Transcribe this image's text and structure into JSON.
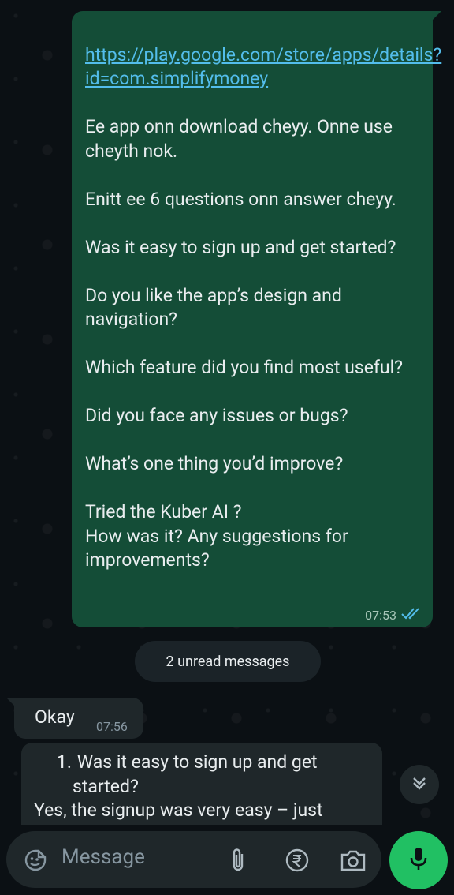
{
  "outgoing_message": {
    "link": "https://play.google.com/store/apps/details?id=com.simplifymoney",
    "text": "Ee app onn download cheyy. Onne use cheyth nok.\n\nEnitt ee 6 questions onn answer cheyy.\n\nWas it easy to sign up and get started?\n\nDo you like the app’s design and navigation?\n\nWhich feature did you find most useful?\n\nDid you face any issues or bugs?\n\nWhat’s one thing you’d improve?\n\nTried the Kuber AI ?\nHow was it? Any suggestions for improvements?",
    "time": "07:53",
    "status_icon": "double-check-read"
  },
  "unread_divider": "2 unread messages",
  "incoming_1": {
    "text": "Okay",
    "time": "07:56"
  },
  "incoming_2": {
    "item_number": "1.",
    "item_text_line1": "Was it easy to sign up and get",
    "item_text_line2": "started?",
    "answer": "Yes, the signup was very easy – just"
  },
  "composer": {
    "placeholder": "Message",
    "icons": [
      "emoji-icon",
      "attach-icon",
      "rupee-icon",
      "camera-icon",
      "mic-icon"
    ]
  },
  "colors": {
    "outgoing_bubble": "#144d37",
    "incoming_bubble": "#1f272a",
    "link": "#53bdeb",
    "mic_button": "#21c063",
    "read_ticks": "#53bdeb"
  }
}
